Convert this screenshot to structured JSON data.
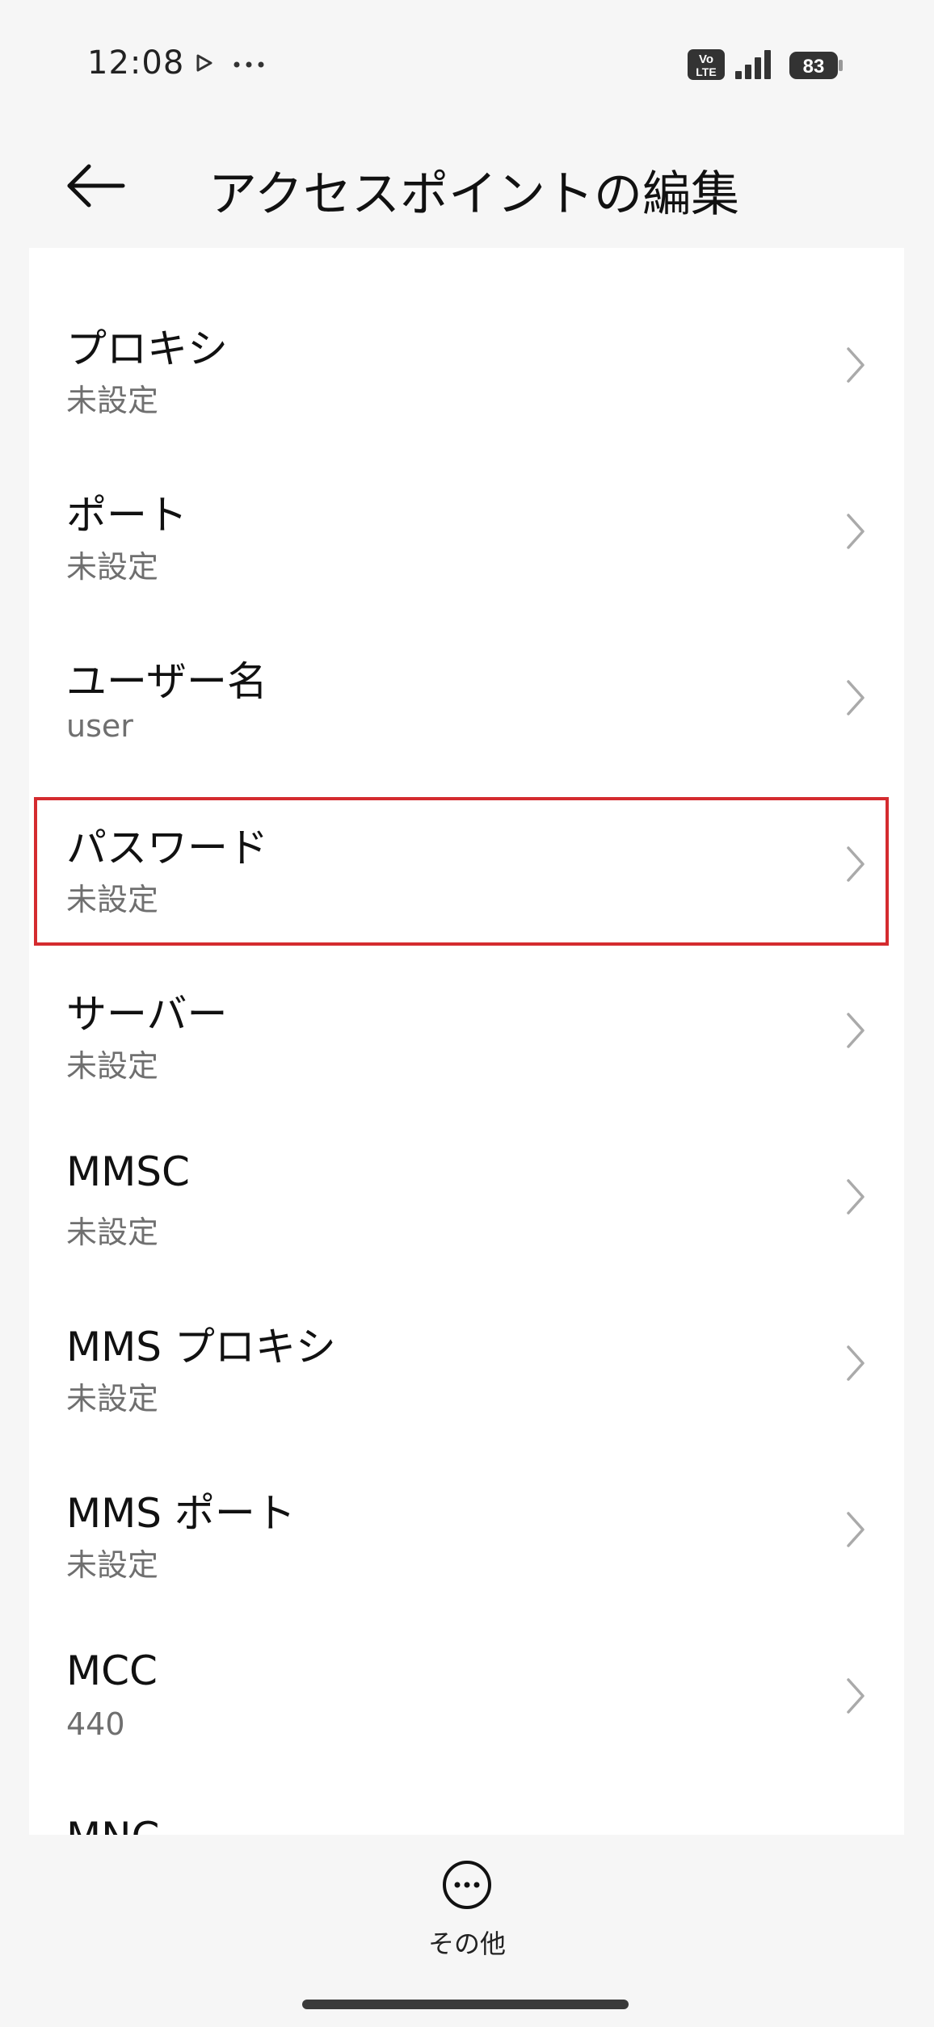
{
  "status_bar": {
    "time": "12:08",
    "battery_level": "83",
    "icons": [
      "play-icon",
      "more-dots-icon",
      "volte-icon",
      "signal-icon",
      "battery-icon"
    ]
  },
  "header": {
    "title": "アクセスポイントの編集",
    "back_icon": "back-arrow-icon"
  },
  "settings": [
    {
      "label": "プロキシ",
      "value": "未設定"
    },
    {
      "label": "ポート",
      "value": "未設定"
    },
    {
      "label": "ユーザー名",
      "value": "user"
    },
    {
      "label": "パスワード",
      "value": "未設定"
    },
    {
      "label": "サーバー",
      "value": "未設定"
    },
    {
      "label": "MMSC",
      "value": "未設定"
    },
    {
      "label": "MMS プロキシ",
      "value": "未設定"
    },
    {
      "label": "MMS ポート",
      "value": "未設定"
    },
    {
      "label": "MCC",
      "value": "440"
    },
    {
      "label": "MNC",
      "value": ""
    }
  ],
  "highlight": {
    "color": "#d42b2f",
    "item": "パスワード"
  },
  "bottom_bar": {
    "more_label": "その他",
    "more_icon": "more-circle-icon"
  }
}
